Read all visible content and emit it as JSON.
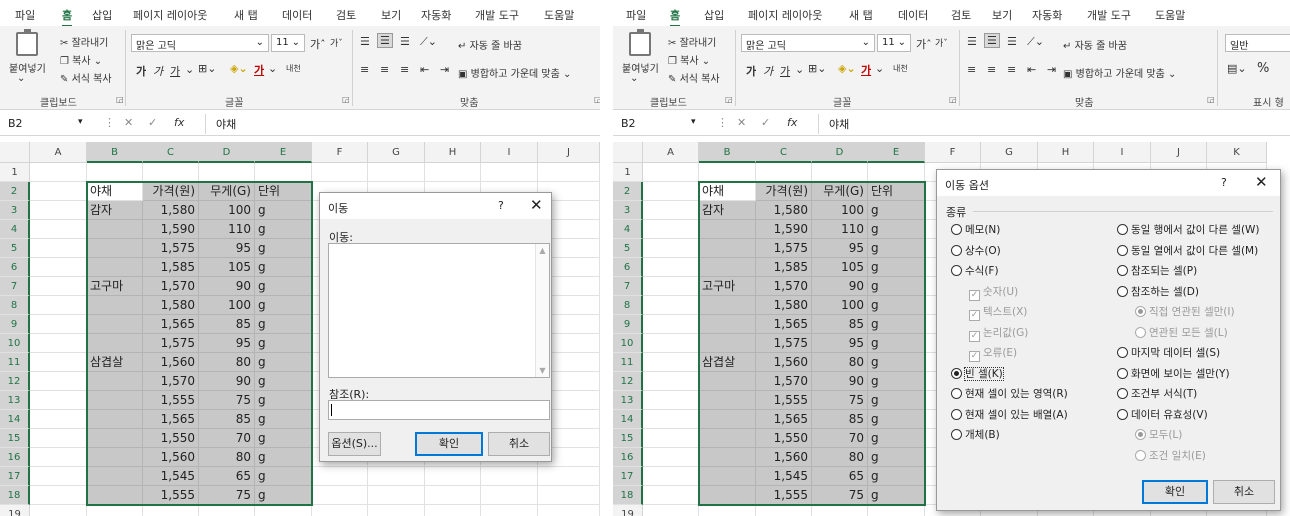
{
  "ribbon": {
    "tabs": [
      "파일",
      "홈",
      "삽입",
      "페이지 레이아웃",
      "새 탭",
      "데이터",
      "검토",
      "보기",
      "자동화",
      "개발 도구",
      "도움말"
    ],
    "clipboard": {
      "paste": "붙여넣기",
      "cut": "잘라내기",
      "copy": "복사",
      "format_painter": "서식 복사",
      "group_label": "클립보드"
    },
    "font": {
      "name": "맑은 고딕",
      "size": "11",
      "group_label": "글꼴",
      "grow": "가",
      "shrink": "가",
      "bold": "가",
      "italic": "가",
      "underline": "가",
      "color_a": "가",
      "phonetic": "내천"
    },
    "alignment": {
      "wrap": "자동 줄 바꿈",
      "merge": "병합하고 가운데 맞춤",
      "group_label": "맞춤"
    },
    "number": {
      "format": "일반",
      "group_label": "표시 형",
      "percent": "%"
    }
  },
  "formula_bar": {
    "name_box": "B2",
    "fx": "fx",
    "cancel": "✕",
    "enter": "✓",
    "value": "야채"
  },
  "columns_left": [
    "A",
    "B",
    "C",
    "D",
    "E",
    "F",
    "G",
    "H",
    "I",
    "J"
  ],
  "columns_right": [
    "A",
    "B",
    "C",
    "D",
    "E",
    "F",
    "G",
    "H",
    "I",
    "J",
    "K"
  ],
  "rows": [
    "1",
    "2",
    "3",
    "4",
    "5",
    "6",
    "7",
    "8",
    "9",
    "10",
    "11",
    "12",
    "13",
    "14",
    "15",
    "16",
    "17",
    "18",
    "19"
  ],
  "table": {
    "headers": [
      "야채",
      "가격(원)",
      "무게(G)",
      "단위"
    ],
    "rows": [
      [
        "감자",
        "1,580",
        "100",
        "g"
      ],
      [
        "",
        "1,590",
        "110",
        "g"
      ],
      [
        "",
        "1,575",
        "95",
        "g"
      ],
      [
        "",
        "1,585",
        "105",
        "g"
      ],
      [
        "고구마",
        "1,570",
        "90",
        "g"
      ],
      [
        "",
        "1,580",
        "100",
        "g"
      ],
      [
        "",
        "1,565",
        "85",
        "g"
      ],
      [
        "",
        "1,575",
        "95",
        "g"
      ],
      [
        "삼겹살",
        "1,560",
        "80",
        "g"
      ],
      [
        "",
        "1,570",
        "90",
        "g"
      ],
      [
        "",
        "1,555",
        "75",
        "g"
      ],
      [
        "",
        "1,565",
        "85",
        "g"
      ],
      [
        "",
        "1,550",
        "70",
        "g"
      ],
      [
        "",
        "1,560",
        "80",
        "g"
      ],
      [
        "",
        "1,545",
        "65",
        "g"
      ],
      [
        "",
        "1,555",
        "75",
        "g"
      ]
    ]
  },
  "goto_dialog": {
    "title": "이동",
    "help": "?",
    "close": "✕",
    "goto_label": "이동:",
    "reference_label": "참조(R):",
    "reference_value": "",
    "options_button": "옵션(S)...",
    "ok_button": "확인",
    "cancel_button": "취소"
  },
  "goto_special_dialog": {
    "title": "이동 옵션",
    "help": "?",
    "close": "✕",
    "group_label": "종류",
    "left_options": [
      {
        "label": "메모(N)",
        "kind": "radio",
        "checked": false,
        "disabled": false,
        "indent": 0
      },
      {
        "label": "상수(O)",
        "kind": "radio",
        "checked": false,
        "disabled": false,
        "indent": 0
      },
      {
        "label": "수식(F)",
        "kind": "radio",
        "checked": false,
        "disabled": false,
        "indent": 0
      },
      {
        "label": "숫자(U)",
        "kind": "check",
        "checked": true,
        "disabled": true,
        "indent": 1
      },
      {
        "label": "텍스트(X)",
        "kind": "check",
        "checked": true,
        "disabled": true,
        "indent": 1
      },
      {
        "label": "논리값(G)",
        "kind": "check",
        "checked": true,
        "disabled": true,
        "indent": 1
      },
      {
        "label": "오류(E)",
        "kind": "check",
        "checked": true,
        "disabled": true,
        "indent": 1
      },
      {
        "label": "빈 셀(K)",
        "kind": "radio",
        "checked": true,
        "disabled": false,
        "indent": 0
      },
      {
        "label": "현재 셀이 있는 영역(R)",
        "kind": "radio",
        "checked": false,
        "disabled": false,
        "indent": 0
      },
      {
        "label": "현재 셀이 있는 배열(A)",
        "kind": "radio",
        "checked": false,
        "disabled": false,
        "indent": 0
      },
      {
        "label": "개체(B)",
        "kind": "radio",
        "checked": false,
        "disabled": false,
        "indent": 0
      }
    ],
    "right_options": [
      {
        "label": "동일 행에서 값이 다른 셀(W)",
        "kind": "radio",
        "checked": false,
        "disabled": false,
        "indent": 0
      },
      {
        "label": "동일 열에서 값이 다른 셀(M)",
        "kind": "radio",
        "checked": false,
        "disabled": false,
        "indent": 0
      },
      {
        "label": "참조되는 셀(P)",
        "kind": "radio",
        "checked": false,
        "disabled": false,
        "indent": 0
      },
      {
        "label": "참조하는 셀(D)",
        "kind": "radio",
        "checked": false,
        "disabled": false,
        "indent": 0
      },
      {
        "label": "직접 연관된 셀만(I)",
        "kind": "radio",
        "checked": true,
        "disabled": true,
        "indent": 1
      },
      {
        "label": "연관된 모든 셀(L)",
        "kind": "radio",
        "checked": false,
        "disabled": true,
        "indent": 1
      },
      {
        "label": "마지막 데이터 셀(S)",
        "kind": "radio",
        "checked": false,
        "disabled": false,
        "indent": 0
      },
      {
        "label": "화면에 보이는 셀만(Y)",
        "kind": "radio",
        "checked": false,
        "disabled": false,
        "indent": 0
      },
      {
        "label": "조건부 서식(T)",
        "kind": "radio",
        "checked": false,
        "disabled": false,
        "indent": 0
      },
      {
        "label": "데이터 유효성(V)",
        "kind": "radio",
        "checked": false,
        "disabled": false,
        "indent": 0
      },
      {
        "label": "모두(L)",
        "kind": "radio",
        "checked": true,
        "disabled": true,
        "indent": 1
      },
      {
        "label": "조건 일치(E)",
        "kind": "radio",
        "checked": false,
        "disabled": true,
        "indent": 1
      }
    ],
    "ok_button": "확인",
    "cancel_button": "취소"
  },
  "colors": {
    "accent": "#217346",
    "selection_fill": "#c8c8c8",
    "dialog_bg": "#f0f0f0",
    "default_button_border": "#0078d7"
  }
}
